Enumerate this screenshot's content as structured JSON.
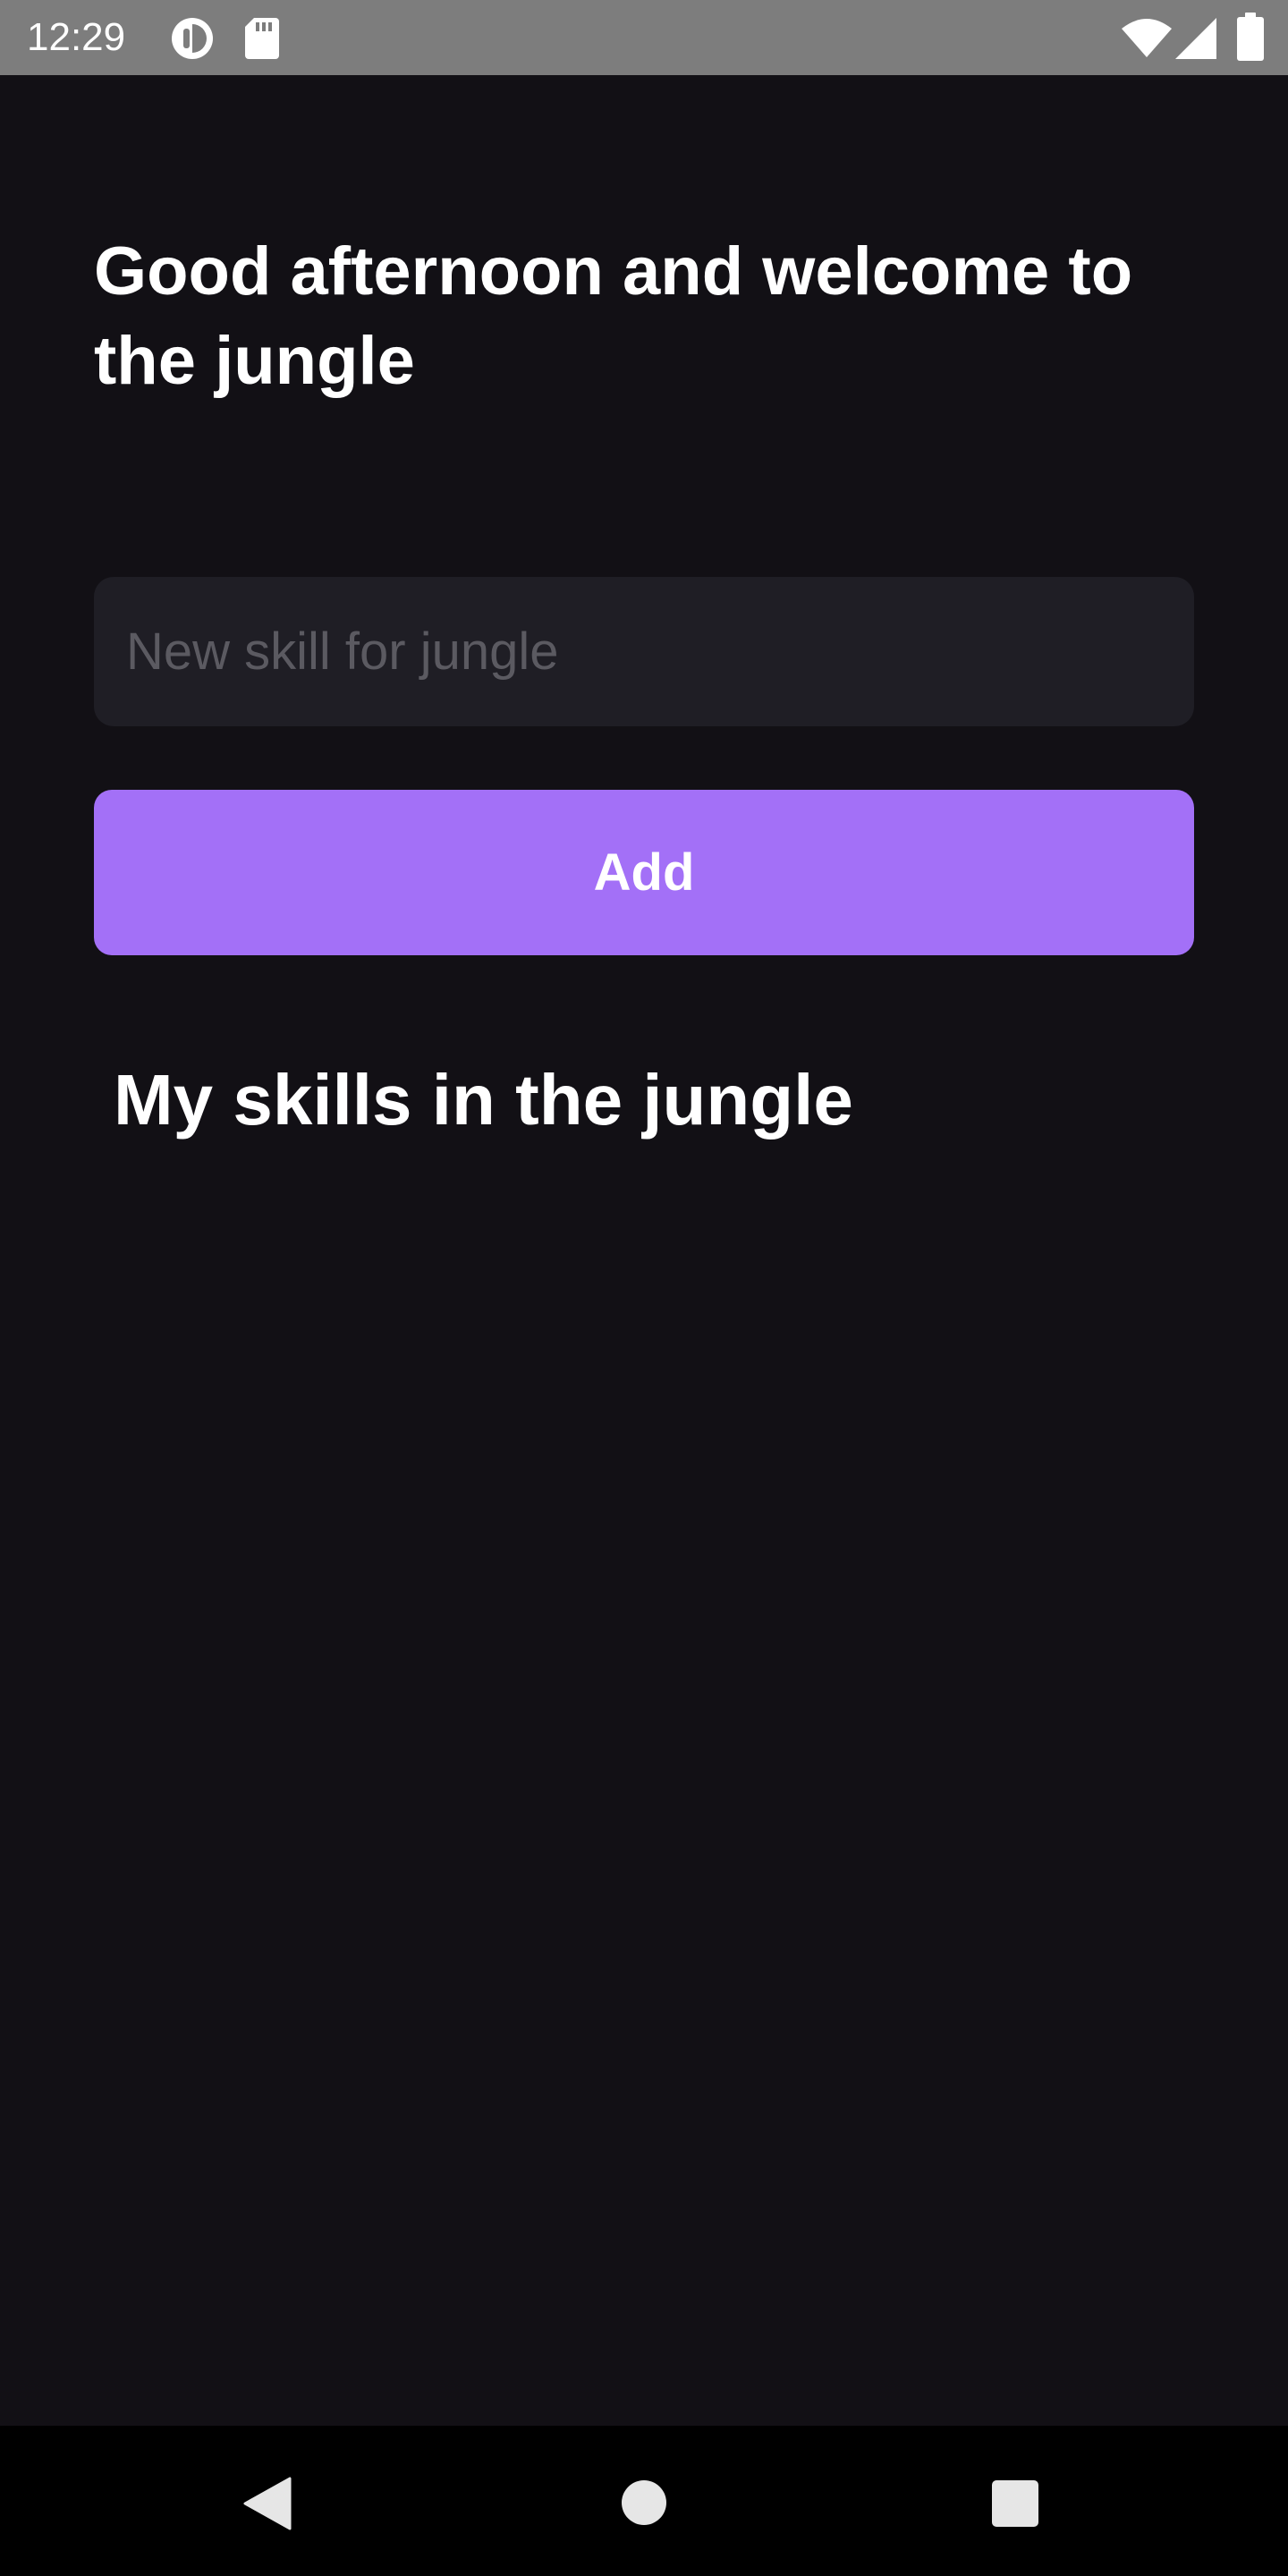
{
  "status_bar": {
    "time": "12:29",
    "icons": [
      "data-saver-icon",
      "sd-card-icon",
      "wifi-icon",
      "signal-icon",
      "battery-icon"
    ]
  },
  "main": {
    "greeting": "Good afternoon and welcome to the jungle",
    "input": {
      "placeholder": "New skill for jungle",
      "value": ""
    },
    "add_button_label": "Add",
    "skills_title": "My skills in the jungle",
    "skills": []
  },
  "nav_bar": {
    "icons": [
      "back-icon",
      "home-icon",
      "recents-icon"
    ]
  },
  "colors": {
    "background": "#121015",
    "input_background": "#1f1e25",
    "accent": "#a370f7",
    "status_bar": "#7d7d7d",
    "nav_bar": "#000000"
  }
}
